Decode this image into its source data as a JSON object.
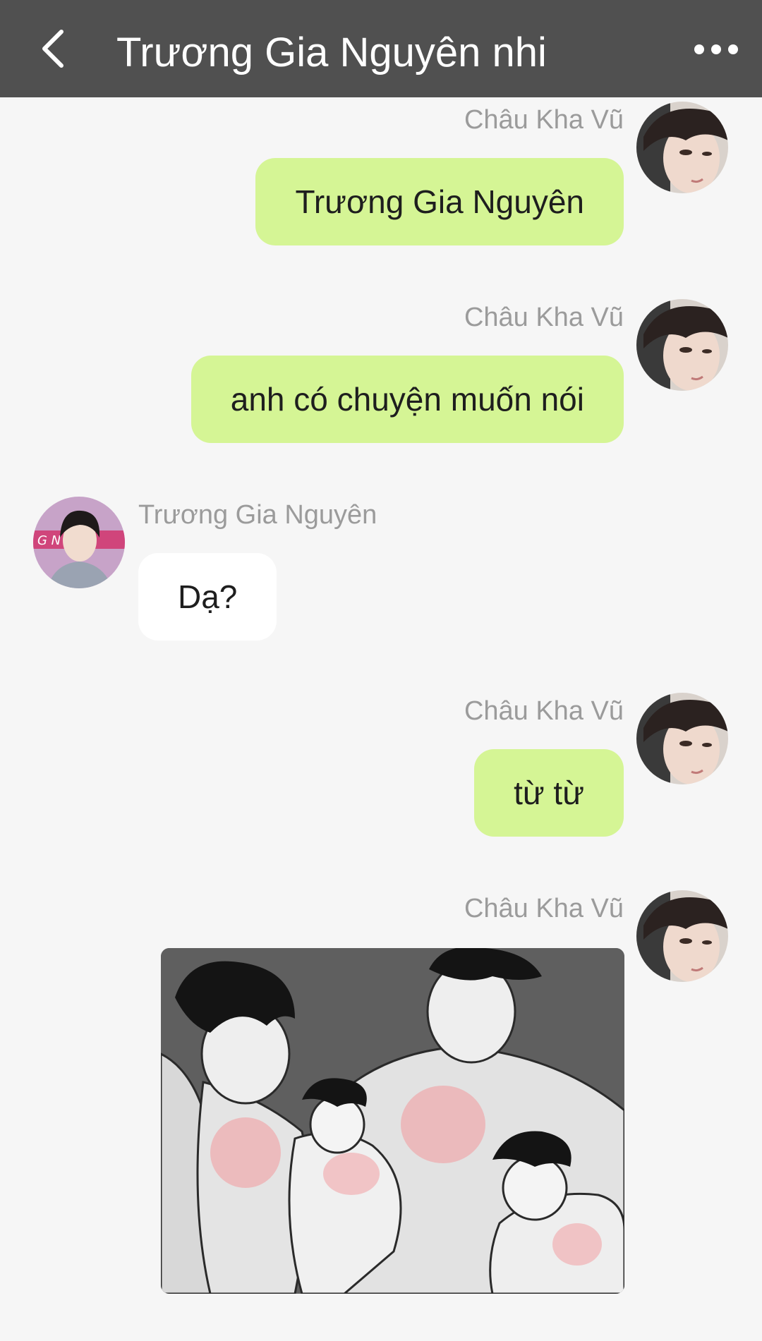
{
  "header": {
    "title": "Trương Gia Nguyên nhi"
  },
  "messages": [
    {
      "sender": "Châu Kha Vũ",
      "text": "Trương Gia Nguyên",
      "side": "right"
    },
    {
      "sender": "Châu Kha Vũ",
      "text": "anh có chuyện muốn nói",
      "side": "right"
    },
    {
      "sender": "Trương Gia Nguyên",
      "text": "Dạ?",
      "side": "left"
    },
    {
      "sender": "Châu Kha Vũ",
      "text": "từ từ",
      "side": "right"
    },
    {
      "sender": "Châu Kha Vũ",
      "image": "meme-sticker",
      "side": "right"
    }
  ],
  "icons": {
    "back": "chevron-left-icon",
    "more": "more-dots-icon"
  },
  "colors": {
    "header_bg": "#505050",
    "outgoing_bubble": "#d5f595",
    "incoming_bubble": "#ffffff",
    "background": "#f6f6f6",
    "name_text": "#9b9b9b"
  }
}
